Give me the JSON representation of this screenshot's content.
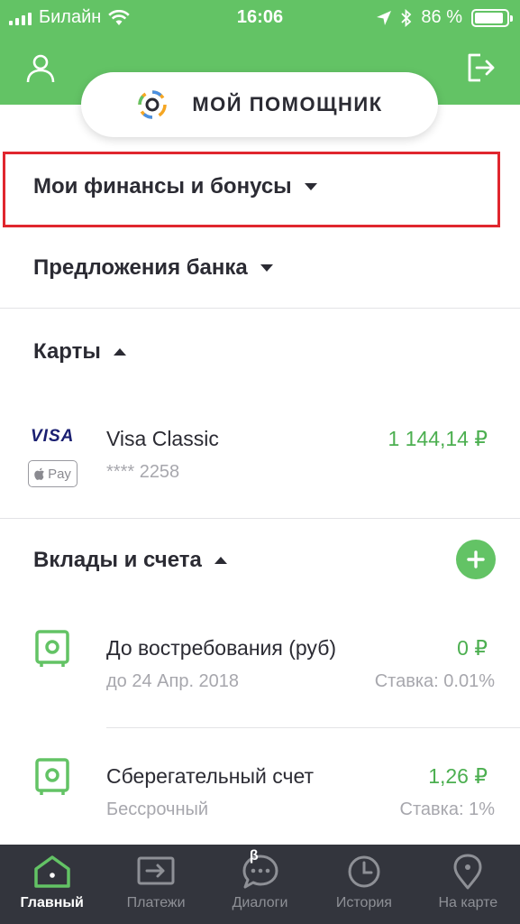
{
  "status_bar": {
    "carrier": "Билайн",
    "time": "16:06",
    "battery": "86 %"
  },
  "header": {
    "assistant_label": "МОЙ ПОМОЩНИК"
  },
  "sections": {
    "finances": "Мои финансы и бонусы",
    "offers": "Предложения банка",
    "cards": "Карты",
    "deposits": "Вклады и счета"
  },
  "cards": [
    {
      "brand": "VISA",
      "wallet": "Pay",
      "name": "Visa Classic",
      "number": "**** 2258",
      "balance": "1 144,14 ₽"
    }
  ],
  "accounts": [
    {
      "name": "До востребования (руб)",
      "term": "до 24 Апр. 2018",
      "balance": "0 ₽",
      "rate": "Ставка: 0.01%"
    },
    {
      "name": "Сберегательный счет",
      "term": "Бессрочный",
      "balance": "1,26 ₽",
      "rate": "Ставка: 1%"
    }
  ],
  "tabbar": {
    "home": "Главный",
    "payments": "Платежи",
    "dialogs": "Диалоги",
    "dialogs_badge": "β",
    "history": "История",
    "map": "На карте"
  },
  "colors": {
    "brand_green": "#63c365",
    "amount_green": "#4caf50",
    "highlight_red": "#e0262e",
    "tabbar_bg": "#33353d"
  },
  "icons": [
    "profile-icon",
    "logout-icon",
    "assistant-logo-icon",
    "wifi-icon",
    "location-icon",
    "bluetooth-icon",
    "safe-icon",
    "plus-icon",
    "home-icon",
    "payments-icon",
    "dialogs-icon",
    "history-icon",
    "map-pin-icon",
    "apple-icon"
  ]
}
